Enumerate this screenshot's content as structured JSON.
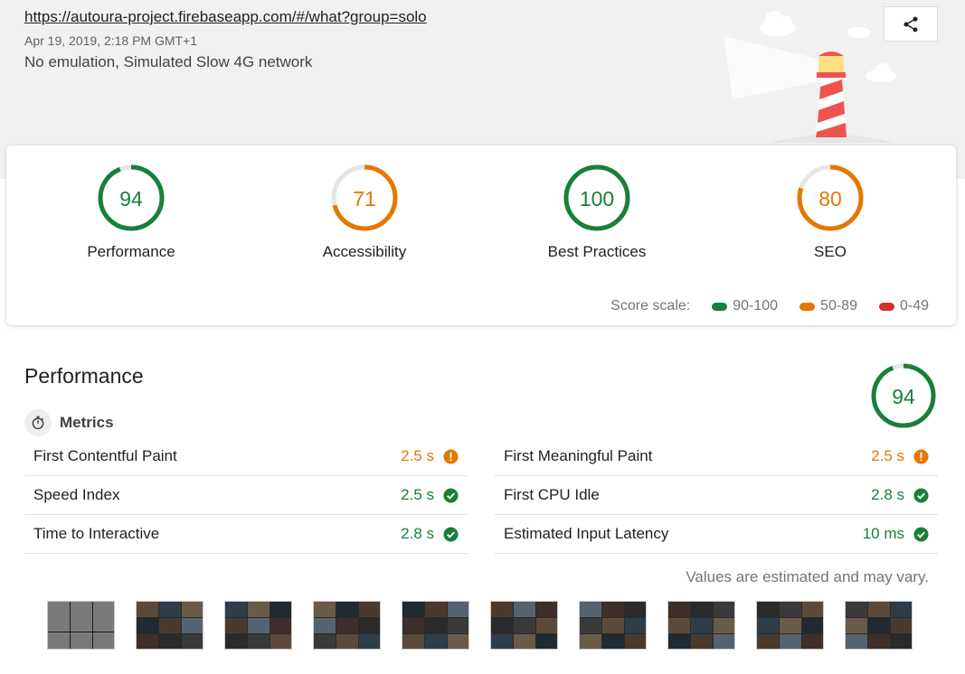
{
  "header": {
    "url": "https://autoura-project.firebaseapp.com/#/what?group=solo",
    "date": "Apr 19, 2019, 2:18 PM GMT+1",
    "environment": "No emulation, Simulated Slow 4G network"
  },
  "colors": {
    "pass": "#18803a",
    "average": "#e67700",
    "fail": "#d32f2f",
    "track": "#e5e5e5"
  },
  "scores": [
    {
      "label": "Performance",
      "value": "94",
      "score": 94,
      "rating": "pass"
    },
    {
      "label": "Accessibility",
      "value": "71",
      "score": 71,
      "rating": "average"
    },
    {
      "label": "Best Practices",
      "value": "100",
      "score": 100,
      "rating": "pass"
    },
    {
      "label": "SEO",
      "value": "80",
      "score": 80,
      "rating": "average"
    }
  ],
  "score_scale": {
    "label": "Score scale:",
    "ranges": [
      "90-100",
      "50-89",
      "0-49"
    ]
  },
  "performance": {
    "title": "Performance",
    "score": "94",
    "score_value": 94,
    "metrics_title": "Metrics",
    "metrics_left": [
      {
        "name": "First Contentful Paint",
        "value": "2.5 s",
        "status": "average"
      },
      {
        "name": "Speed Index",
        "value": "2.5 s",
        "status": "pass"
      },
      {
        "name": "Time to Interactive",
        "value": "2.8 s",
        "status": "pass"
      }
    ],
    "metrics_right": [
      {
        "name": "First Meaningful Paint",
        "value": "2.5 s",
        "status": "average"
      },
      {
        "name": "First CPU Idle",
        "value": "2.8 s",
        "status": "pass"
      },
      {
        "name": "Estimated Input Latency",
        "value": "10 ms",
        "status": "pass"
      }
    ],
    "estimate_note": "Values are estimated and may vary."
  },
  "icons": {
    "share": "share-icon",
    "timer": "stopwatch-icon",
    "average": "info-circle-icon",
    "pass": "check-circle-icon"
  },
  "filmstrip_frames": 10
}
